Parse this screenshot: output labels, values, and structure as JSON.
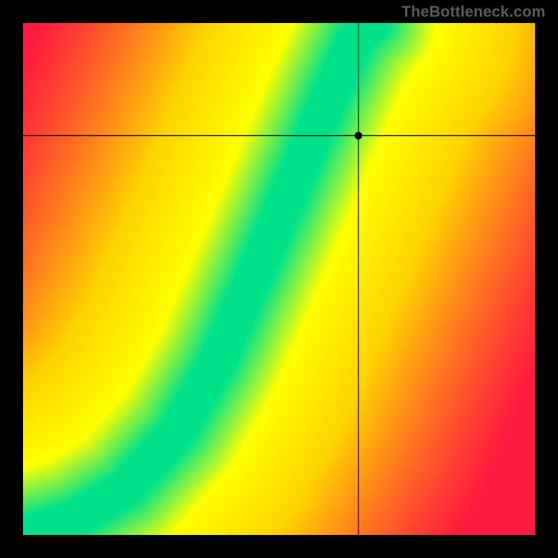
{
  "watermark": "TheBottleneck.com",
  "chart_data": {
    "type": "heatmap",
    "title": "",
    "xlabel": "",
    "ylabel": "",
    "xlim": [
      0,
      1
    ],
    "ylim": [
      0,
      1
    ],
    "grid": false,
    "legend": false,
    "colorscale": [
      {
        "t": 0.0,
        "color": "#ff1a3f"
      },
      {
        "t": 0.5,
        "color": "#ffd400"
      },
      {
        "t": 0.8,
        "color": "#ffff00"
      },
      {
        "t": 1.0,
        "color": "#00e28a"
      }
    ],
    "ridge": [
      {
        "x": 0.0,
        "y": 0.0
      },
      {
        "x": 0.1,
        "y": 0.03
      },
      {
        "x": 0.2,
        "y": 0.09
      },
      {
        "x": 0.3,
        "y": 0.2
      },
      {
        "x": 0.38,
        "y": 0.34
      },
      {
        "x": 0.44,
        "y": 0.48
      },
      {
        "x": 0.5,
        "y": 0.62
      },
      {
        "x": 0.55,
        "y": 0.74
      },
      {
        "x": 0.6,
        "y": 0.86
      },
      {
        "x": 0.65,
        "y": 0.97
      },
      {
        "x": 0.68,
        "y": 1.0
      }
    ],
    "ridge_width": 0.06,
    "marker": {
      "x": 0.655,
      "y": 0.78
    },
    "description": "2D heatmap where value encodes closeness of the (x,y) point to an S-shaped ridge curve. Green = on the band, yellow = near, orange/red = far. Crosshair marks a single (x,y) selection near the edge of the green band."
  }
}
